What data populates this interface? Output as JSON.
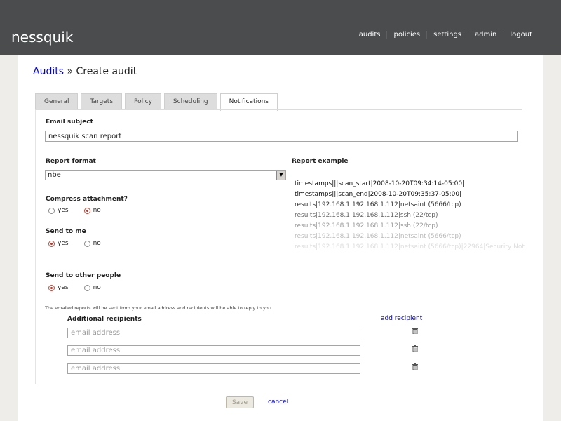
{
  "app": {
    "name": "nessquik"
  },
  "nav": [
    "audits",
    "policies",
    "settings",
    "admin",
    "logout"
  ],
  "breadcrumb": {
    "root": "Audits",
    "separator": "»",
    "current": "Create audit"
  },
  "tabs": [
    {
      "label": "General",
      "active": false
    },
    {
      "label": "Targets",
      "active": false
    },
    {
      "label": "Policy",
      "active": false
    },
    {
      "label": "Scheduling",
      "active": false
    },
    {
      "label": "Notifications",
      "active": true
    }
  ],
  "form": {
    "email_subject": {
      "label": "Email subject",
      "value": "nessquik scan report"
    },
    "report_format": {
      "label": "Report format",
      "value": "nbe"
    },
    "compress": {
      "label": "Compress attachment?",
      "options": [
        "yes",
        "no"
      ],
      "selected": "no"
    },
    "send_to_me": {
      "label": "Send to me",
      "options": [
        "yes",
        "no"
      ],
      "selected": "yes"
    },
    "send_to_others": {
      "label": "Send to other people",
      "options": [
        "yes",
        "no"
      ],
      "selected": "yes"
    },
    "note": "The emailed reports will be sent from your email address and recipients will be able to reply to you.",
    "additional_recipients": {
      "label": "Additional recipients",
      "add_link": "add recipient",
      "placeholder": "email address",
      "count": 3
    }
  },
  "report_example": {
    "label": "Report example",
    "lines": [
      "timestamps|||scan_start|2008-10-20T09:34:14-05:00|",
      "timestamps|||scan_end|2008-10-20T09:35:37-05:00|",
      "results|192.168.1|192.168.1.112|netsaint (5666/tcp)",
      "results|192.168.1|192.168.1.112|ssh (22/tcp)",
      "results|192.168.1|192.168.1.112|ssh (22/tcp)",
      "results|192.168.1|192.168.1.112|netsaint (5666/tcp)",
      "results|192.168.1|192.168.1.112|netsaint (5666/tcp)|22964|Security Not"
    ],
    "line_colors": [
      "#111111",
      "#111111",
      "#333333",
      "#666666",
      "#999999",
      "#bbbbbb",
      "#dddddd"
    ]
  },
  "actions": {
    "save": "Save",
    "cancel": "cancel"
  },
  "icons": {
    "trash": "trash-icon",
    "select_arrow": "chevron-down-icon"
  }
}
